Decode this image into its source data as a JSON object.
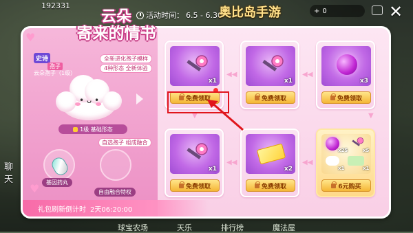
{
  "header": {
    "uid": "192331",
    "event_time_label": "活动时间：",
    "event_time_value": "6.5 - 6.30",
    "game_logo": "奥比岛手游",
    "currency_value": "0"
  },
  "side": {
    "left_chars": [
      "聊",
      "天"
    ],
    "bottom_nav": [
      "球宝农场",
      "天乐",
      "排行榜",
      "魔法屋"
    ]
  },
  "title": {
    "line1": "云朵",
    "line2": "寄来的情书"
  },
  "pet": {
    "rarity": "史诗",
    "type_tag": "孢子",
    "name_line": "云朵孢子（1级）",
    "feature_1": "全新进化孢子模样",
    "feature_2": "4种形态 全新体验",
    "level_label": "1级 基础形态",
    "combine_label": "自选孢子 组成融合",
    "slot_gene": "基因药丸",
    "slot_combine": "自由融合特权"
  },
  "countdown": {
    "label": "礼包刷新倒计时",
    "value": "2天06:20:00"
  },
  "cards": [
    {
      "qty": "x1",
      "btn": "免费领取",
      "kind": "key"
    },
    {
      "qty": "x1",
      "btn": "免费领取",
      "kind": "key"
    },
    {
      "qty": "x3",
      "btn": "免费领取",
      "kind": "orb"
    },
    {
      "qty": "x1",
      "btn": "免费领取",
      "kind": "key"
    },
    {
      "qty": "x2",
      "btn": "免费领取",
      "kind": "ticket"
    },
    {
      "qty": "x1",
      "btn": "6元购买",
      "kind": "bundle",
      "sub_qty": [
        "x25",
        "x5",
        "x1",
        "x1"
      ]
    }
  ],
  "colors": {
    "panel_pink": "#fde6f3",
    "button_gold": "#f5b636",
    "highlight_red": "#e0151c"
  },
  "icons": {
    "close": "close-icon",
    "clock": "clock-icon",
    "lock": "lock-icon"
  }
}
